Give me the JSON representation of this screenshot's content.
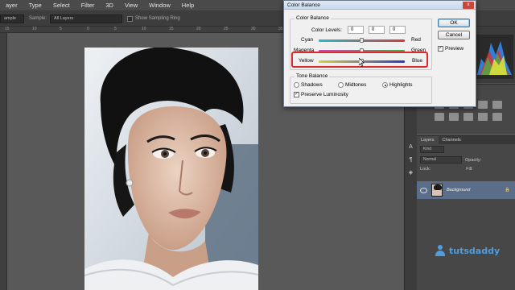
{
  "menubar": {
    "items": [
      "ayer",
      "Type",
      "Select",
      "Filter",
      "3D",
      "View",
      "Window",
      "Help"
    ]
  },
  "optionsbar": {
    "sample_size": "ample",
    "sample_label": "Sample:",
    "sample_value": "All Layers",
    "show_ring_label": "Show Sampling Ring"
  },
  "ruler": {
    "ticks": [
      "15",
      "10",
      "5",
      "0",
      "5",
      "10",
      "15",
      "20",
      "25",
      "30",
      "35",
      "40",
      "45",
      "50"
    ]
  },
  "dialog": {
    "title": "Color Balance",
    "color_balance_group": "Color Balance",
    "color_levels_label": "Color Levels:",
    "levels": [
      "0",
      "0",
      "0"
    ],
    "sliders": [
      {
        "left": "Cyan",
        "right": "Red",
        "value": 0
      },
      {
        "left": "Magenta",
        "right": "Green",
        "value": 0
      },
      {
        "left": "Yellow",
        "right": "Blue",
        "value": 0
      }
    ],
    "tone_balance_group": "Tone Balance",
    "tones": [
      {
        "label": "Shadows",
        "selected": false
      },
      {
        "label": "Midtones",
        "selected": false
      },
      {
        "label": "Highlights",
        "selected": true
      }
    ],
    "preserve_luminosity_label": "Preserve Luminosity",
    "preserve_luminosity": true,
    "ok_label": "OK",
    "cancel_label": "Cancel",
    "preview_label": "Preview",
    "preview": true,
    "close_glyph": "x"
  },
  "layers_panel": {
    "tabs": [
      "Layers",
      "Channels"
    ],
    "kind_label": "Kind",
    "blend_mode": "Normal",
    "opacity_label": "Opacity:",
    "lock_label": "Lock:",
    "fill_label": "Fill:",
    "layer_name": "Background"
  },
  "watermark": {
    "text": "tutsdaddy"
  },
  "colors": {
    "highlight": "#e0272a",
    "layer_selected": "#5a6e8a",
    "watermark": "#4d9de0"
  }
}
